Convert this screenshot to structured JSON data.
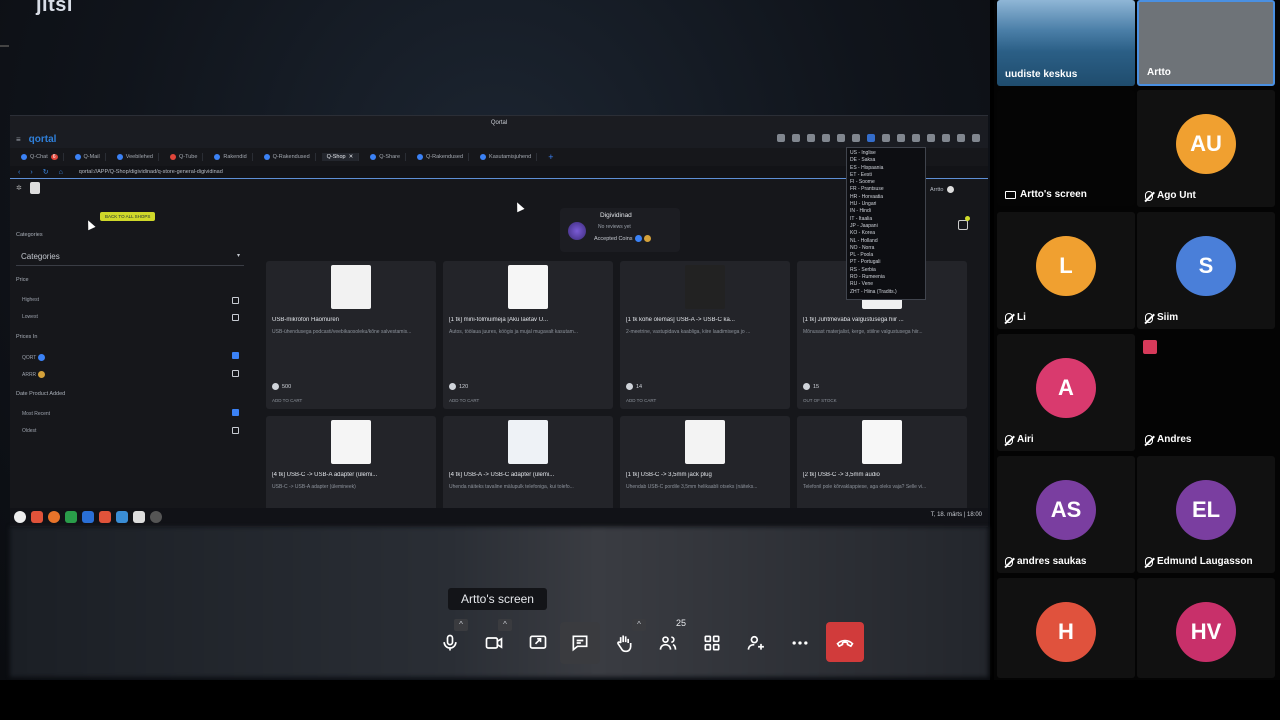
{
  "meeting": {
    "brand": "jitsi",
    "screen_caption": "Artto's screen",
    "participant_count": "25"
  },
  "shared_screen": {
    "window_title": "Qortal",
    "app_name": "qortal",
    "tabs": [
      {
        "label": "Q-Chat",
        "badge": "6",
        "active": false
      },
      {
        "label": "Q-Mail",
        "active": false
      },
      {
        "label": "Veebilehed",
        "active": false
      },
      {
        "label": "Q-Tube",
        "active": false
      },
      {
        "label": "Rakendid",
        "active": false
      },
      {
        "label": "Q-Rakendused",
        "active": false
      },
      {
        "label": "Q-Shop",
        "active": true
      },
      {
        "label": "Q-Share",
        "active": false
      },
      {
        "label": "Q-Rakendused",
        "active": false
      },
      {
        "label": "Kasutamisjuhend",
        "active": false
      }
    ],
    "url": "qortal://APP/Q-Shop/digividinad/q-store-general-digividinad",
    "languages": [
      "US - Inglise",
      "DE - Saksa",
      "ES - Hispaania",
      "ET - Eesti",
      "FI - Soome",
      "FR - Prantsuse",
      "HR - Horvaatia",
      "HU - Ungari",
      "IN - Hindi",
      "IT - Itaalia",
      "JP - Jaapani",
      "KO - Korea",
      "NL - Holland",
      "NO - Norra",
      "PL - Poola",
      "PT - Portugali",
      "RS - Serbia",
      "RO - Rumeenia",
      "RU - Vene",
      "ZHT - Hiina (Tradits.)"
    ],
    "back_button": "BACK TO ALL SHOPS",
    "filters": {
      "categories_toggle": "Categories",
      "categories_select": "Categories",
      "price_label": "Price",
      "price_options": [
        {
          "label": "Highest",
          "checked": false
        },
        {
          "label": "Lowest",
          "checked": false
        }
      ],
      "prices_in_label": "Prices In",
      "currency_options": [
        {
          "label": "QORT",
          "checked": true,
          "color": "#3b82f6"
        },
        {
          "label": "ARRR",
          "checked": false,
          "color": "#d4a13a"
        }
      ],
      "date_label": "Date Product Added",
      "date_options": [
        {
          "label": "Most Recent",
          "checked": true
        },
        {
          "label": "Oldest",
          "checked": false
        }
      ]
    },
    "store": {
      "name": "Digividinad",
      "reviews": "No reviews yet",
      "accepted": "Accepted Coins"
    },
    "user": "Arrtto",
    "products": [
      {
        "title": "USB-mikrofon Haomuren",
        "desc": "USB-ühendusega podcasti/veebikaosoleku/kõne salvestamis...",
        "price": "500",
        "action": "ADD TO CART"
      },
      {
        "title": "[1 tk] mini-tolmuimeja [Aku laetav U...",
        "desc": "Autos, töölaua juures, köögis ja mujal mugavalt kasutam...",
        "price": "120",
        "action": "ADD TO CART"
      },
      {
        "title": "[1 tk kohe olemas] USB-A -> USB-C ka...",
        "desc": "2-meetrine, vastupidava kaabliga, kiire laadimisega jo ...",
        "price": "14",
        "action": "ADD TO CART"
      },
      {
        "title": "[1 tk] Juhtmevaba valgustusega hiir ...",
        "desc": "Mõnusast materjalist, kerge, stiilne valgustusega hiir...",
        "price": "15",
        "action": "OUT OF STOCK"
      },
      {
        "title": "[4 tk] USB-C -> USB-A adapter (ülemi...",
        "desc": "USB-C -> USB-A adapter (ülemineek)",
        "price": "",
        "action": ""
      },
      {
        "title": "[4 tk] USB-A -> USB-C adapter (ülemi...",
        "desc": "Ühenda näiteks tavaline mälupulk telefoniga, kui tolefo...",
        "price": "",
        "action": ""
      },
      {
        "title": "[1 tk] USB-C -> 3,5mm jack plug",
        "desc": "Ühendab USB-C pordile 3,5mm helikaabli otseks (näiteks...",
        "price": "",
        "action": ""
      },
      {
        "title": "[2 tk] USB-C -> 3,5mm audio",
        "desc": "Telefonil pole kõrvaklappiese, aga oleks vaja? Selle vi...",
        "price": "",
        "action": ""
      }
    ],
    "clock": "T, 18. märts | 18:00"
  },
  "toolbar": {
    "buttons": [
      "microphone-icon",
      "camera-icon",
      "screen-share-icon",
      "chat-icon",
      "raise-hand-icon",
      "participants-icon",
      "tile-view-icon",
      "invite-icon",
      "more-icon",
      "hangup-icon"
    ]
  },
  "participants": [
    {
      "name": "uudiste keskus",
      "type": "video",
      "muted": false
    },
    {
      "name": "Artto",
      "type": "video",
      "muted": false
    },
    {
      "name": "",
      "type": "blank",
      "muted": false
    },
    {
      "name": "AU",
      "full": "Ago Unt",
      "color": "#f0a030",
      "muted": true
    },
    {
      "name": "Artto's screen",
      "type": "screen",
      "muted": false
    },
    {
      "name": "L",
      "full": "Li",
      "color": "#f0a030",
      "muted": true
    },
    {
      "name": "S",
      "full": "Siim",
      "color": "#4a7fd9",
      "muted": true
    },
    {
      "name": "A",
      "full": "Airi",
      "color": "#d93a6e",
      "muted": true
    },
    {
      "name": "",
      "full": "Andres",
      "color": "",
      "muted": true
    },
    {
      "name": "AS",
      "full": "andres saukas",
      "color": "#7a3ea0",
      "muted": true
    },
    {
      "name": "EL",
      "full": "Edmund Laugasson",
      "color": "#7a3ea0",
      "muted": true
    },
    {
      "name": "H",
      "full": "",
      "color": "#e0523d",
      "muted": false
    },
    {
      "name": "HV",
      "full": "",
      "color": "#c8306a",
      "muted": false
    }
  ]
}
